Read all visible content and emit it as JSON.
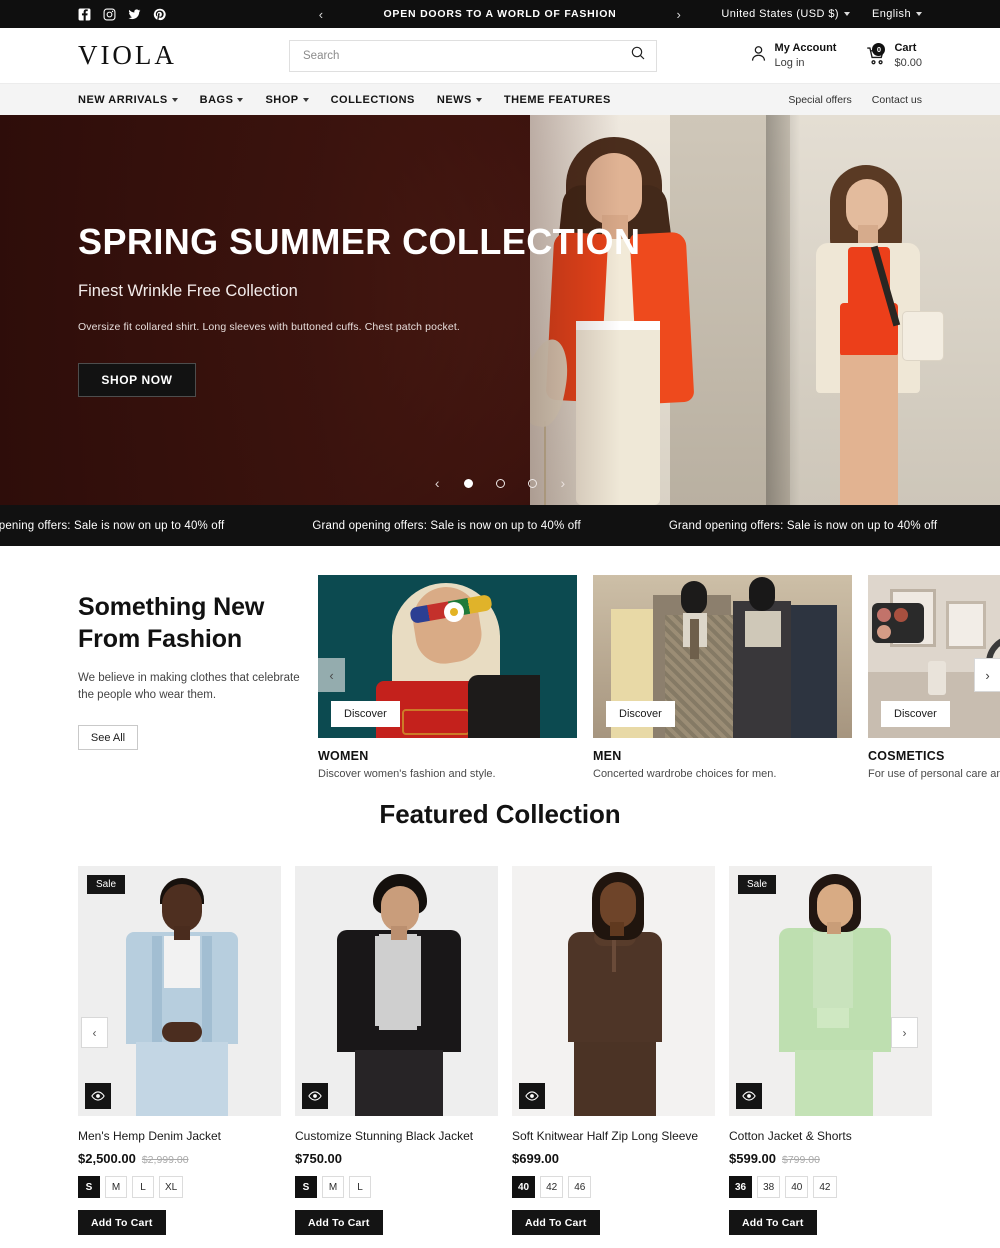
{
  "topbar": {
    "social": [
      {
        "name": "facebook-icon",
        "glyph": "f"
      },
      {
        "name": "instagram-icon",
        "glyph": "◎"
      },
      {
        "name": "twitter-icon",
        "glyph": "t"
      },
      {
        "name": "pinterest-icon",
        "glyph": "P"
      }
    ],
    "announcement": "OPEN DOORS TO A WORLD OF FASHION",
    "prev_label": "‹",
    "next_label": "›",
    "country": "United States (USD $)",
    "language": "English"
  },
  "header": {
    "logo": "VIOLA",
    "search_placeholder": "Search",
    "search_value": "",
    "account_title": "My Account",
    "account_sub": "Log in",
    "cart_title": "Cart",
    "cart_total": "$0.00",
    "cart_count": "0"
  },
  "nav": {
    "items": [
      {
        "label": "NEW ARRIVALS",
        "caret": true
      },
      {
        "label": "BAGS",
        "caret": true
      },
      {
        "label": "SHOP",
        "caret": true
      },
      {
        "label": "COLLECTIONS",
        "caret": false
      },
      {
        "label": "NEWS",
        "caret": true
      },
      {
        "label": "THEME FEATURES",
        "caret": false
      }
    ],
    "right": [
      {
        "label": "Special offers"
      },
      {
        "label": "Contact us"
      }
    ]
  },
  "hero": {
    "title": "SPRING SUMMER COLLECTION",
    "subtitle": "Finest Wrinkle Free Collection",
    "description": "Oversize fit collared shirt. Long sleeves with buttoned cuffs. Chest patch pocket.",
    "cta": "SHOP NOW",
    "prev_label": "‹",
    "next_label": "›",
    "dots": 3,
    "active_dot": 0,
    "bg_color": "#3f140f"
  },
  "marquee": {
    "text": "Grand opening offers: Sale is now on up to 40% off",
    "repeat": 6
  },
  "something_new": {
    "heading_line1": "Something New",
    "heading_line2": "From Fashion",
    "paragraph": "We believe in making clothes that celebrate the people who wear them.",
    "button": "See All",
    "prev_label": "‹",
    "next_label": "›",
    "categories": [
      {
        "name": "WOMEN",
        "subtitle": "Discover women's fashion and style.",
        "cta": "Discover",
        "color": "#0c4a50"
      },
      {
        "name": "MEN",
        "subtitle": "Concerted wardrobe choices for men.",
        "cta": "Discover",
        "color": "#a79784"
      },
      {
        "name": "COSMETICS",
        "subtitle": "For use of personal care and s",
        "cta": "Discover",
        "color": "#ded6cc"
      }
    ]
  },
  "featured": {
    "heading": "Featured Collection",
    "prev_label": "‹",
    "next_label": "›",
    "add_to_cart": "Add To Cart",
    "sale_badge": "Sale",
    "quickview_icon": "eye-icon",
    "products": [
      {
        "name": "Men's Hemp Denim Jacket",
        "price": "$2,500.00",
        "compare_at": "$2,999.00",
        "on_sale": true,
        "sizes": [
          "S",
          "M",
          "L",
          "XL"
        ],
        "selected_size": "S"
      },
      {
        "name": "Customize Stunning Black Jacket",
        "price": "$750.00",
        "compare_at": "",
        "on_sale": false,
        "sizes": [
          "S",
          "M",
          "L"
        ],
        "selected_size": "S"
      },
      {
        "name": "Soft Knitwear Half Zip Long Sleeve",
        "price": "$699.00",
        "compare_at": "",
        "on_sale": false,
        "sizes": [
          "40",
          "42",
          "46"
        ],
        "selected_size": "40"
      },
      {
        "name": "Cotton Jacket & Shorts",
        "price": "$599.00",
        "compare_at": "$799.00",
        "on_sale": true,
        "sizes": [
          "36",
          "38",
          "40",
          "42"
        ],
        "selected_size": "36"
      }
    ]
  }
}
